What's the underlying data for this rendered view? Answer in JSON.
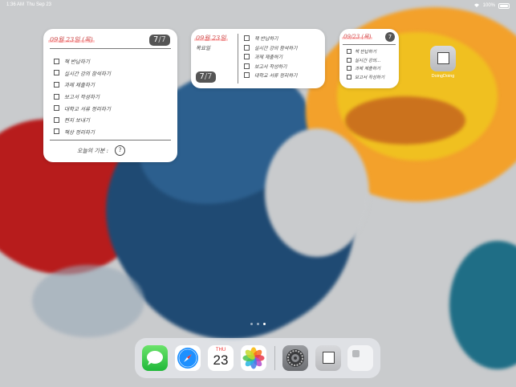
{
  "status": {
    "time": "1:36 AM",
    "date": "Thu Sep 23",
    "battery": "100%"
  },
  "widget_large": {
    "date": "09월 23일 (목)",
    "badge_main": "7",
    "badge_sub": "/7",
    "tasks": [
      "책 반납하기",
      "실시간 강의 참석하기",
      "과제 제출하기",
      "보고서 작성하기",
      "대학교 서류 정리하기",
      "편지 보내기",
      "책상 정리하기"
    ],
    "mood_label": "오늘의 기분 :",
    "mood_value": "?"
  },
  "widget_medium": {
    "date": "09월 23일",
    "weekday": "목요일",
    "badge_main": "7",
    "badge_sub": "/7",
    "tasks": [
      "책 반납하기",
      "실시간 강의 참석하기",
      "과제 제출하기",
      "보고서 작성하기",
      "대학교 서류 정리하기"
    ]
  },
  "widget_small": {
    "date": "09/23 (목)",
    "badge": "7",
    "tasks": [
      "책 반납하기",
      "실시간 강의...",
      "과제 제출하기",
      "보고서 작성하기"
    ]
  },
  "home_app": {
    "label": "DoingDoing"
  },
  "dock": {
    "calendar_weekday": "THU",
    "calendar_day": "23",
    "apps": [
      "Messages",
      "Safari",
      "Calendar",
      "Photos",
      "Settings",
      "DoingDoing",
      "App Library"
    ]
  },
  "page_indicator": {
    "count": 3,
    "active": 3
  }
}
